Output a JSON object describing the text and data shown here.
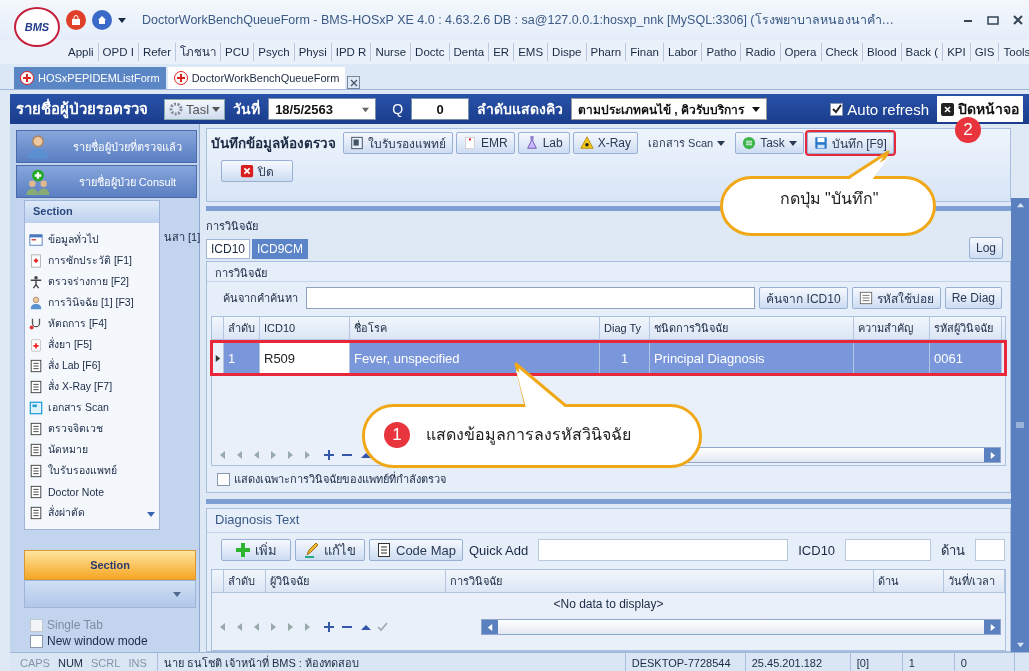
{
  "window": {
    "logo": "BMS",
    "title": "DoctorWorkBenchQueueForm - BMS-HOSxP XE 4.0 : 4.63.2.6 DB : sa@127.0.0.1:hosxp_nnk [MySQL:3306] (โรงพยาบาลหนองนาคำ…"
  },
  "menu": [
    "Appli",
    "OPD I",
    "Refer",
    "โภชนา",
    "PCU",
    "Psych",
    "Physi",
    "IPD R",
    "Nurse",
    "Doctc",
    "Denta",
    "ER",
    "EMS",
    "Dispe",
    "Pharn",
    "Finan",
    "Labor",
    "Patho",
    "Radio",
    "Opera",
    "Check",
    "Blood",
    "Back (",
    "KPI",
    "GIS",
    "Tools"
  ],
  "doc_tabs": [
    {
      "label": "HOSxPEPIDEMListForm",
      "selected": false
    },
    {
      "label": "DoctorWorkBenchQueueForm",
      "selected": true
    }
  ],
  "queue_bar": {
    "title": "รายชื่อผู้ป่วยรอตรวจ",
    "task_button": "Tasl",
    "date_label": "วันที่",
    "date": "18/5/2563",
    "q_label": "Q",
    "q": "0",
    "order_label": "ลำดับแสดงคิว",
    "order": "ตามประเภทคนไข้ , คิวรับบริการ",
    "auto_refresh": {
      "label": "Auto refresh",
      "checked": true
    },
    "close_button": "ปิดหน้าจอ"
  },
  "sidebar": {
    "nav": [
      {
        "label": "รายชื่อผู้ป่วยที่ตรวจแล้ว",
        "kind": "doctor"
      },
      {
        "label": "รายชื่อผู้ป่วย Consult",
        "kind": "consult"
      }
    ],
    "hidden_tab": "นสา [1]",
    "section_panel": {
      "title": "Section",
      "items": [
        {
          "label": "ข้อมูลทั่วไป",
          "kind": "info"
        },
        {
          "label": "การซักประวัติ [F1]",
          "kind": "history"
        },
        {
          "label": "ตรวจร่างกาย  [F2]",
          "kind": "body"
        },
        {
          "label": "การวินิจฉัย [1] [F3]",
          "kind": "doctor"
        },
        {
          "label": "หัตถการ [F4]",
          "kind": "procedure"
        },
        {
          "label": "สั่งยา [F5]",
          "kind": "drug"
        },
        {
          "label": "สั่ง Lab  [F6]",
          "kind": "list"
        },
        {
          "label": "สั่ง X-Ray  [F7]",
          "kind": "list"
        },
        {
          "label": "เอกสาร Scan",
          "kind": "scan"
        },
        {
          "label": "ตรวจจิตเวช",
          "kind": "list"
        },
        {
          "label": "นัดหมาย",
          "kind": "list"
        },
        {
          "label": "ใบรับรองแพทย์",
          "kind": "list"
        },
        {
          "label": "Doctor Note",
          "kind": "list"
        },
        {
          "label": "สั่งผ่าตัด",
          "kind": "list"
        }
      ]
    },
    "section_bar": "Section",
    "options": [
      {
        "label": "Single Tab",
        "checked": false,
        "disabled": true
      },
      {
        "label": "New window mode",
        "checked": false,
        "disabled": false
      }
    ]
  },
  "toolbar": {
    "title": "บันทึกข้อมูลห้องตรวจ",
    "buttons": [
      {
        "label": "ใบรับรองแพทย์",
        "kind": "cert",
        "highlighted": false
      },
      {
        "label": "EMR",
        "kind": "emr",
        "highlighted": false
      },
      {
        "label": "Lab",
        "kind": "lab",
        "highlighted": false
      },
      {
        "label": "X-Ray",
        "kind": "xray",
        "highlighted": false
      },
      {
        "label": "เอกสาร Scan",
        "kind": "menu",
        "highlighted": false
      },
      {
        "label": "Task",
        "kind": "task",
        "highlighted": false
      },
      {
        "label": "บันทึก [F9]",
        "kind": "save",
        "highlighted": true
      }
    ],
    "close_button": "ปิด"
  },
  "diagnosis": {
    "caption": "การวินิจฉัย",
    "tabs": [
      {
        "label": "ICD10",
        "selected": true
      },
      {
        "label": "ICD9CM",
        "selected": false
      }
    ],
    "log_button": "Log",
    "group_title": "การวินิจฉัย",
    "search_label": "ค้นจากคำค้นหา",
    "search_buttons": [
      {
        "label": "ค้นจาก ICD10",
        "kind": "text"
      },
      {
        "label": "รหัสใช้บ่อย",
        "kind": "icon"
      },
      {
        "label": "Re Diag",
        "kind": "text"
      }
    ],
    "columns": [
      "ลำดับ",
      "ICD10",
      "ชื่อโรค",
      "Diag Ty",
      "ชนิดการวินิจฉัย",
      "ความสำคัญ",
      "รหัสผู้วินิจฉัย"
    ],
    "rows": [
      {
        "selected": true,
        "highlighted": true,
        "cells": [
          {
            "text": "1",
            "focused": false
          },
          {
            "text": "R509",
            "focused": true
          },
          {
            "text": "Fever, unspecified",
            "focused": false
          },
          {
            "text": "1",
            "focused": false
          },
          {
            "text": "Principal Diagnosis",
            "focused": false
          },
          {
            "text": "",
            "focused": false
          },
          {
            "text": "0061",
            "focused": false
          }
        ]
      }
    ],
    "own_only": {
      "label": "แสดงเฉพาะการวินิจฉัยของแพทย์ที่กำลังตรวจ",
      "checked": false
    }
  },
  "diagnosis_text": {
    "title": "Diagnosis Text",
    "buttons": [
      {
        "label": "เพิ่ม",
        "kind": "add"
      },
      {
        "label": "แก้ไข",
        "kind": "edit"
      },
      {
        "label": "Code Map",
        "kind": "doc"
      }
    ],
    "fields": [
      {
        "label": "Quick Add"
      },
      {
        "label": "ICD10"
      },
      {
        "label": "ด้าน"
      }
    ],
    "columns": [
      "ลำดับ",
      "ผู้วินิจฉัย",
      "การวินิจฉัย",
      "ด้าน",
      "วันที่/เวลา"
    ],
    "empty_text": "<No data to display>"
  },
  "callouts": [
    {
      "number": "2",
      "text": "กดปุ่ม \"บันทึก\""
    },
    {
      "number": "1",
      "text": "แสดงข้อมูลการลงรหัสวินิจฉัย"
    }
  ],
  "status_bar": {
    "keys": [
      {
        "label": "CAPS",
        "on": false
      },
      {
        "label": "NUM",
        "on": true
      },
      {
        "label": "SCRL",
        "on": false
      },
      {
        "label": "INS",
        "on": false
      }
    ],
    "user": "นาย ธนโชติ  เจ้าหน้าที่ BMS : ห้องทดสอบ",
    "cells": [
      "DESKTOP-7728544",
      "25.45.201.182",
      "[0]",
      "1",
      "0"
    ]
  }
}
